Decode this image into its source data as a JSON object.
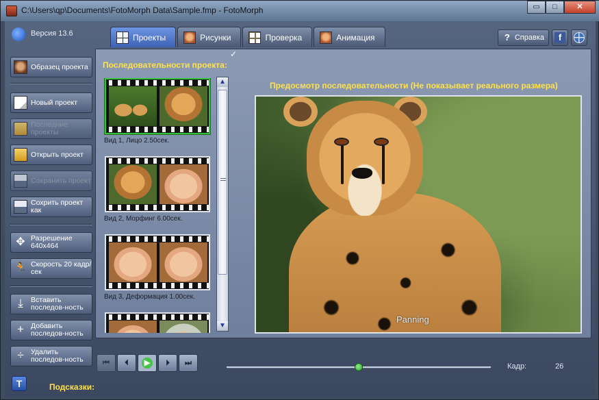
{
  "window": {
    "title": "C:\\Users\\qp\\Documents\\FotoMorph Data\\Sample.fmp - FotoMorph",
    "minimize": "▭",
    "maximize": "□",
    "close": "✕"
  },
  "version": "Версия 13.6",
  "tabs": [
    {
      "label": "Проекты",
      "icon": "grid-icon",
      "active": true
    },
    {
      "label": "Рисунки",
      "icon": "face-icon"
    },
    {
      "label": "Проверка",
      "icon": "check-grid-icon"
    },
    {
      "label": "Анимация",
      "icon": "animation-icon"
    }
  ],
  "help": {
    "label": "Справка",
    "facebook": "f"
  },
  "sidebar": {
    "sample_project": "Образец проекта",
    "new_project": "Новый проект",
    "recent_projects": "Последние проекты",
    "open_project": "Открыть проект",
    "save_project": "Сохранить проект",
    "save_project_as": "Сохрить проект как",
    "resolution": "Разрешение 640x464",
    "speed": "Скорость 20 кадр/сек",
    "insert_sequence": "Вставить последов-ность",
    "add_sequence": "Добавить последов-ность",
    "delete_sequence": "Удалить последов-ность"
  },
  "panel": {
    "sequences_title": "Последовательности проекта:",
    "checkmark": "✓",
    "preview_title": "Предосмотр последовательности (Не показывает реального размера)",
    "preview_overlay": "Panning"
  },
  "sequences": [
    {
      "caption": "Вид 1,  Лицо 2.50сек.",
      "selected": true
    },
    {
      "caption": "Вид 2,  Морфинг 6.00сек."
    },
    {
      "caption": "Вид 3,  Деформация 1.00сек."
    },
    {
      "caption": ""
    }
  ],
  "controls": {
    "first": "⏮",
    "prev": "⏴",
    "play": "▶",
    "next": "⏵",
    "last": "⏭",
    "frame_label": "Кадр:",
    "frame_value": "26",
    "slider_position": 0.5
  },
  "hints": {
    "button": "T",
    "label": "Подсказки:"
  }
}
